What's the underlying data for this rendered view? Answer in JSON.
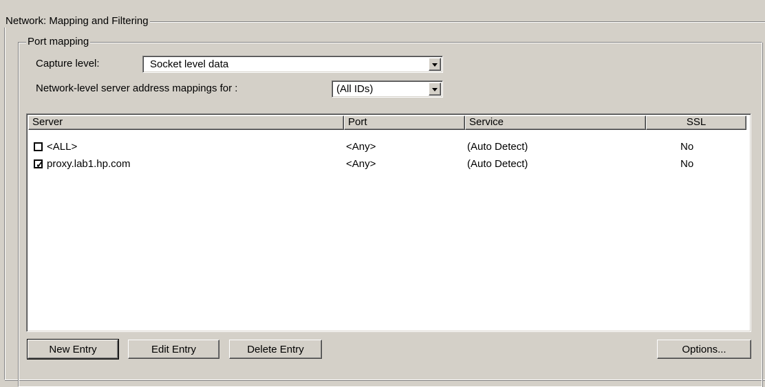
{
  "outer_group": {
    "title": "Network: Mapping and Filtering"
  },
  "port_mapping": {
    "title": "Port mapping",
    "capture_level": {
      "label": "Capture level:",
      "value": "Socket level data"
    },
    "address_mappings": {
      "label": "Network-level server address mappings for :",
      "value": "(All IDs)"
    },
    "table": {
      "columns": [
        "Server",
        "Port",
        "Service",
        "SSL"
      ],
      "rows": [
        {
          "checked": false,
          "server": "<ALL>",
          "port": "<Any>",
          "service": "(Auto Detect)",
          "ssl": "No"
        },
        {
          "checked": true,
          "server": "proxy.lab1.hp.com",
          "port": "<Any>",
          "service": "(Auto Detect)",
          "ssl": "No"
        }
      ]
    },
    "buttons": {
      "new_entry": "New Entry",
      "edit_entry": "Edit Entry",
      "delete_entry": "Delete Entry",
      "options": "Options..."
    }
  },
  "icons": {
    "checkbox_checked_glyph": "✓",
    "dropdown_arrow": "chevron-down-icon"
  }
}
